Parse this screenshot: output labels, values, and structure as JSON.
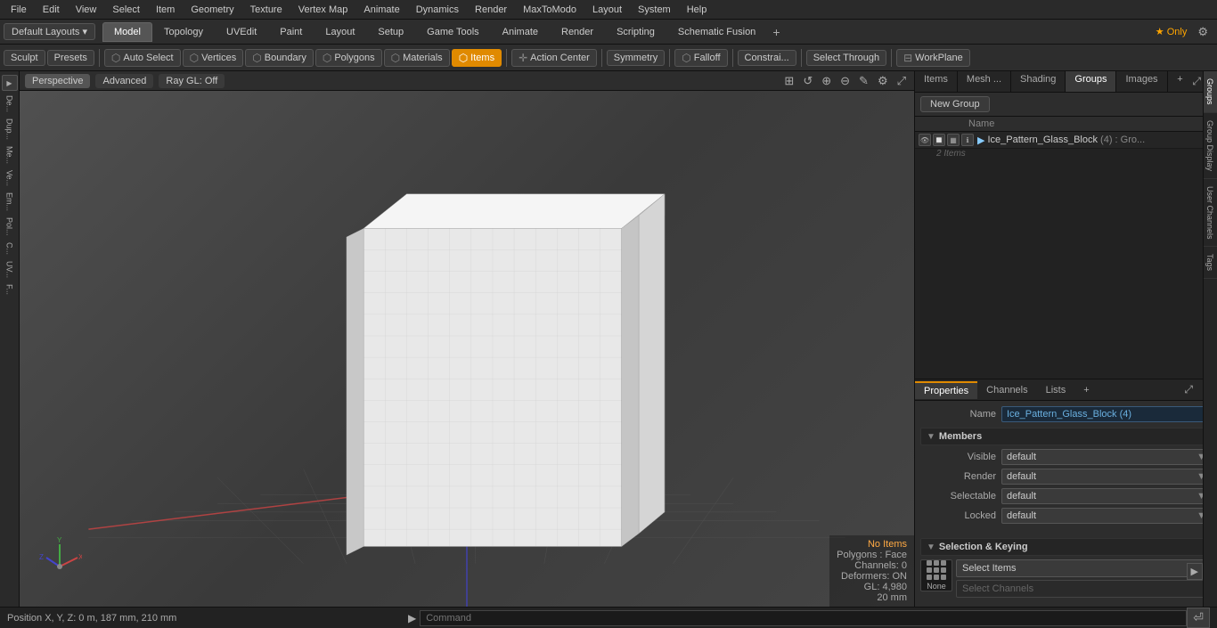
{
  "menubar": {
    "items": [
      "File",
      "Edit",
      "View",
      "Select",
      "Item",
      "Geometry",
      "Texture",
      "Vertex Map",
      "Animate",
      "Dynamics",
      "Render",
      "MaxToModo",
      "Layout",
      "System",
      "Help"
    ]
  },
  "layout_bar": {
    "dropdown_label": "Default Layouts ▾",
    "tabs": [
      "Model",
      "Topology",
      "UVEdit",
      "Paint",
      "Layout",
      "Setup",
      "Game Tools",
      "Animate",
      "Render",
      "Scripting",
      "Schematic Fusion"
    ],
    "active_tab": "Model",
    "add_icon": "+",
    "star_label": "★ Only",
    "gear_icon": "⚙"
  },
  "toolbar": {
    "sculpt_label": "Sculpt",
    "presets_label": "Presets",
    "auto_select_label": "Auto Select",
    "vertices_label": "Vertices",
    "boundary_label": "Boundary",
    "polygons_label": "Polygons",
    "materials_label": "Materials",
    "items_label": "Items",
    "action_center_label": "Action Center",
    "symmetry_label": "Symmetry",
    "falloff_label": "Falloff",
    "constraints_label": "Constrai...",
    "select_through_label": "Select Through",
    "workplane_label": "WorkPlane"
  },
  "viewport": {
    "tabs": [
      "Perspective",
      "Advanced",
      "Ray GL: Off"
    ],
    "active_tab": "Perspective"
  },
  "right_panel": {
    "tabs": [
      "Items",
      "Mesh ...",
      "Shading",
      "Groups",
      "Images"
    ],
    "active_tab": "Groups",
    "new_group_btn": "New Group",
    "name_col": "Name",
    "group_name": "Ice_Pattern_Glass_Block",
    "group_suffix": " (4) : Gro...",
    "group_items_count": "2 Items"
  },
  "properties": {
    "tabs": [
      "Properties",
      "Channels",
      "Lists"
    ],
    "active_tab": "Properties",
    "name_label": "Name",
    "name_value": "Ice_Pattern_Glass_Block (4)",
    "members_label": "Members",
    "rows": [
      {
        "label": "Visible",
        "value": "default"
      },
      {
        "label": "Render",
        "value": "default"
      },
      {
        "label": "Selectable",
        "value": "default"
      },
      {
        "label": "Locked",
        "value": "default"
      }
    ],
    "sel_keying_label": "Selection & Keying",
    "none_label": "None",
    "select_items_btn": "Select Items",
    "select_channels_btn": "Select Channels"
  },
  "vtabs": [
    "Groups",
    "Group Display",
    "User Channels",
    "Tags"
  ],
  "status_bar": {
    "coords": "Position X, Y, Z:  0 m, 187 mm, 210 mm",
    "command_placeholder": "Command",
    "arrow": "▶"
  },
  "viewport_status": {
    "no_items": "No Items",
    "polygons": "Polygons : Face",
    "channels": "Channels: 0",
    "deformers": "Deformers: ON",
    "gl": "GL: 4,980",
    "zoom": "20 mm"
  }
}
